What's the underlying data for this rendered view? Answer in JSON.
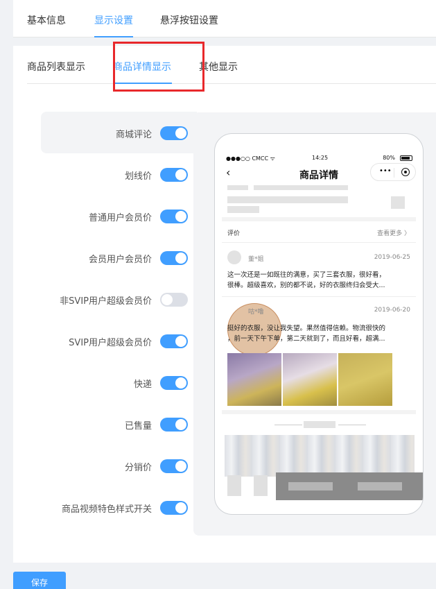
{
  "top_tabs": [
    "基本信息",
    "显示设置",
    "悬浮按钮设置"
  ],
  "sub_tabs": [
    "商品列表显示",
    "商品详情显示",
    "其他显示"
  ],
  "settings": [
    {
      "label": "商城评论",
      "on": true
    },
    {
      "label": "划线价",
      "on": true
    },
    {
      "label": "普通用户会员价",
      "on": true
    },
    {
      "label": "会员用户会员价",
      "on": true
    },
    {
      "label": "非SVIP用户超级会员价",
      "on": false
    },
    {
      "label": "SVIP用户超级会员价",
      "on": true
    },
    {
      "label": "快递",
      "on": true
    },
    {
      "label": "已售量",
      "on": true
    },
    {
      "label": "分销价",
      "on": true
    },
    {
      "label": "商品视频特色样式开关",
      "on": true
    }
  ],
  "phone": {
    "status_left": "●●●○○ CMCC ᯤ",
    "time": "14:25",
    "battery": "80%",
    "title": "商品详情",
    "review_header": "评价",
    "review_more": "查看更多 〉",
    "reviews": [
      {
        "name": "董*姐",
        "date": "2019-06-25",
        "text1": "这一次还是一如既往的满意，买了三套衣服，很好看，",
        "text2": "很棒。超级喜欢，别的都不说，好的衣服终归会受大..."
      },
      {
        "name": "咕*噜",
        "date": "2019-06-20",
        "text1": "挺好的衣服，没让我失望。果然值得信赖。物流很快的",
        "text2": "，前一天下午下单，第二天就到了，而且好看，超满..."
      }
    ]
  },
  "save_label": "保存",
  "colors": {
    "accent": "#409eff",
    "highlight": "#e8282b"
  }
}
